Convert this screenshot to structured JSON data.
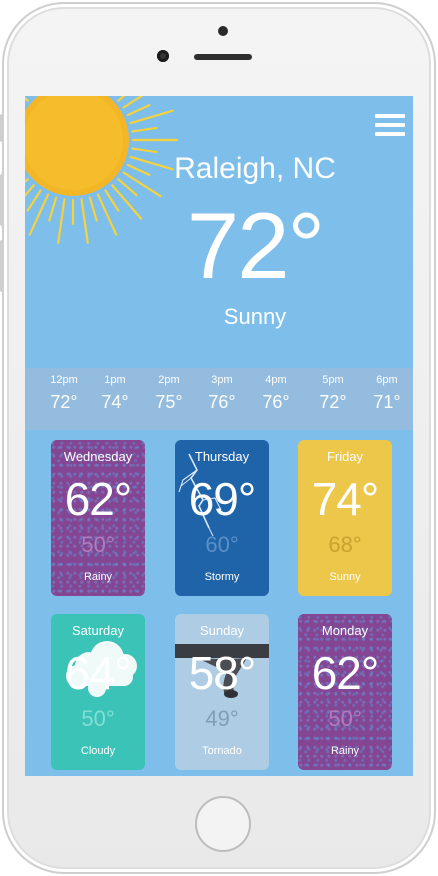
{
  "location": "Raleigh, NC",
  "current": {
    "temp": "72°",
    "condition": "Sunny"
  },
  "hourly": [
    {
      "time": "12pm",
      "temp": "72°"
    },
    {
      "time": "1pm",
      "temp": "74°"
    },
    {
      "time": "2pm",
      "temp": "75°"
    },
    {
      "time": "3pm",
      "temp": "76°"
    },
    {
      "time": "4pm",
      "temp": "76°"
    },
    {
      "time": "5pm",
      "temp": "72°"
    },
    {
      "time": "6pm",
      "temp": "71°"
    }
  ],
  "days": [
    {
      "day": "Wednesday",
      "high": "62°",
      "low": "50°",
      "condition": "Rainy"
    },
    {
      "day": "Thursday",
      "high": "69°",
      "low": "60°",
      "condition": "Stormy"
    },
    {
      "day": "Friday",
      "high": "74°",
      "low": "68°",
      "condition": "Sunny"
    },
    {
      "day": "Saturday",
      "high": "64°",
      "low": "50°",
      "condition": "Cloudy"
    },
    {
      "day": "Sunday",
      "high": "58°",
      "low": "49°",
      "condition": "Tornado"
    },
    {
      "day": "Monday",
      "high": "62°",
      "low": "50°",
      "condition": "Rainy"
    }
  ],
  "icons": {
    "menu": "hamburger-menu-icon",
    "sun": "sun-icon"
  },
  "colors": {
    "screen_bg": "#7dbeeb",
    "rainy": "#844592",
    "stormy": "#1f63a8",
    "sunny": "#ecc74a",
    "cloudy": "#3bc3b8",
    "tornado": "#aecde4"
  }
}
